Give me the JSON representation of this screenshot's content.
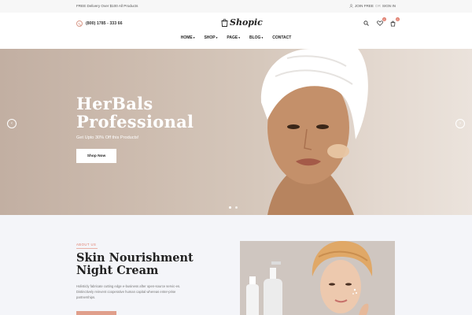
{
  "topbar": {
    "promo": "FREE Delivery Over $100 All Products",
    "join_label": "JOIN FREE",
    "or_label": "OR",
    "signin_label": "SIGN IN"
  },
  "header": {
    "phone": "(800) 1785 - 333 66",
    "logo": "Shopic",
    "wishlist_count": "0",
    "cart_count": "0"
  },
  "nav": {
    "items": [
      {
        "label": "HOME",
        "has_dropdown": true
      },
      {
        "label": "SHOP",
        "has_dropdown": true
      },
      {
        "label": "PAGE",
        "has_dropdown": true
      },
      {
        "label": "BLOG",
        "has_dropdown": true
      },
      {
        "label": "CONTACT",
        "has_dropdown": false
      }
    ],
    "caret": "▾"
  },
  "hero": {
    "title_line1": "HerBals",
    "title_line2": "Professional",
    "subtitle": "Get Upto 30% Off this Products!",
    "button": "Shop Now",
    "arrow_left": "‹",
    "arrow_right": "›",
    "active_slide": 1,
    "slide_count": 2
  },
  "about": {
    "label": "ABOUT US",
    "title_line1": "Skin Nourishment",
    "title_line2": "Night Cream",
    "text": "Holisticly fabricate cutting edge e-business after open-source servic-es. Distinctively reinvent cooperative human capital whereas enter-prise partnerships."
  },
  "colors": {
    "accent": "#e07b6a",
    "button_accent": "#e09f8b",
    "hero_bg": "#cdbcaf",
    "section_bg": "#f4f5f9"
  },
  "icons": [
    "phone-icon",
    "bag-logo-icon",
    "search-icon",
    "heart-icon",
    "cart-icon",
    "user-icon",
    "chevron-left-icon",
    "chevron-right-icon"
  ]
}
